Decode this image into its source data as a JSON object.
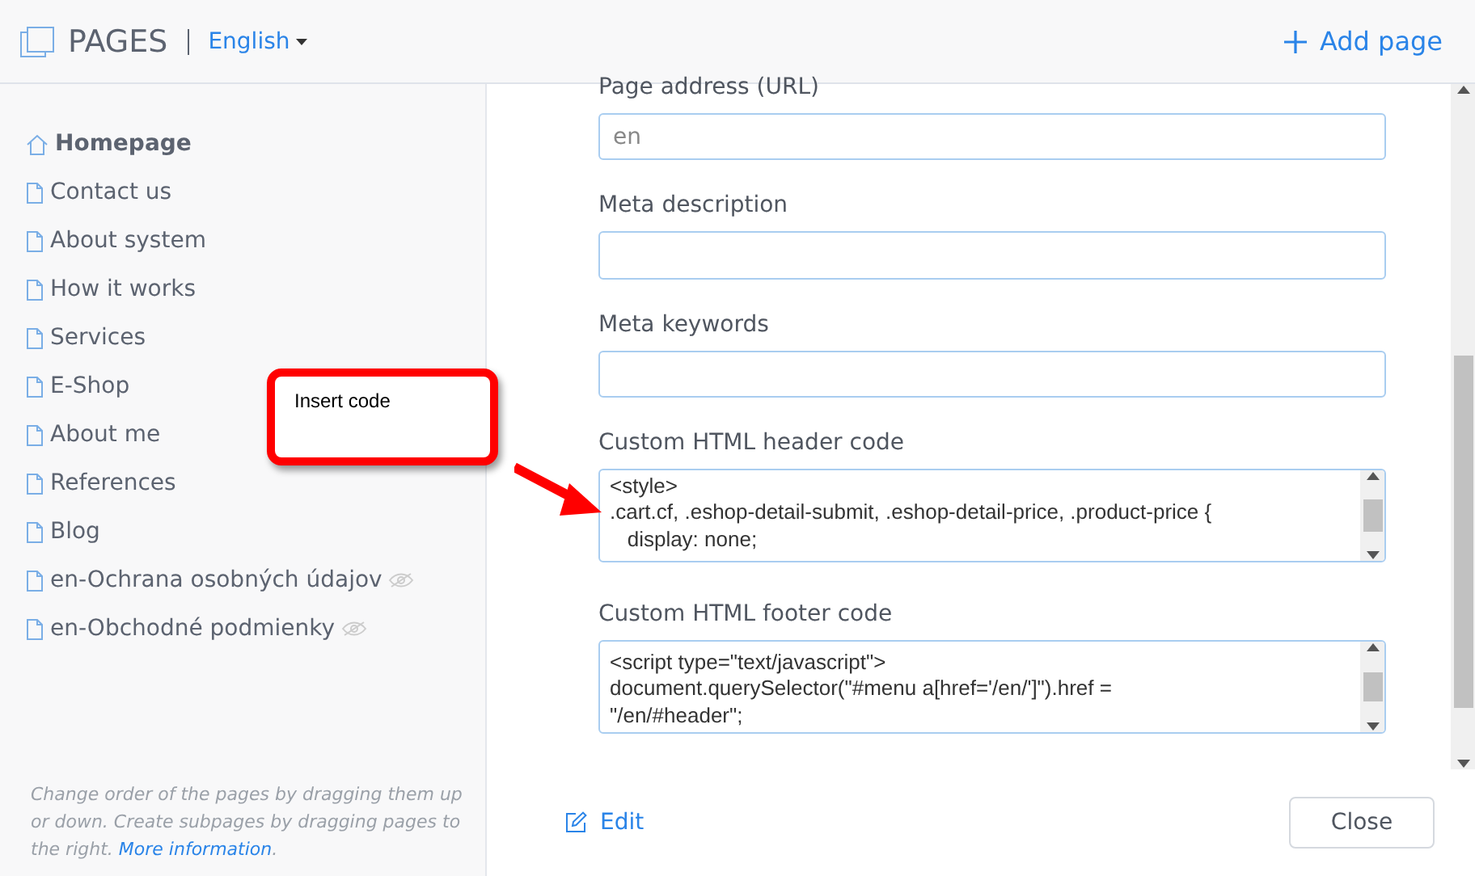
{
  "header": {
    "title": "PAGES",
    "language": "English",
    "add_button": "Add page"
  },
  "sidebar": {
    "items": [
      {
        "label": "Homepage",
        "kind": "home",
        "selected": true,
        "hidden": false
      },
      {
        "label": "Contact us",
        "kind": "page",
        "selected": false,
        "hidden": false
      },
      {
        "label": "About system",
        "kind": "page",
        "selected": false,
        "hidden": false
      },
      {
        "label": "How it works",
        "kind": "page",
        "selected": false,
        "hidden": false
      },
      {
        "label": "Services",
        "kind": "page",
        "selected": false,
        "hidden": false
      },
      {
        "label": "E-Shop",
        "kind": "page",
        "selected": false,
        "hidden": false
      },
      {
        "label": "About me",
        "kind": "page",
        "selected": false,
        "hidden": false
      },
      {
        "label": "References",
        "kind": "page",
        "selected": false,
        "hidden": false
      },
      {
        "label": "Blog",
        "kind": "page",
        "selected": false,
        "hidden": false
      },
      {
        "label": "en-Ochrana osobných údajov",
        "kind": "page",
        "selected": false,
        "hidden": true
      },
      {
        "label": "en-Obchodné podmienky",
        "kind": "page",
        "selected": false,
        "hidden": true
      }
    ],
    "hint": "Change order of the pages by dragging them up or down. Create subpages by dragging pages to the right.",
    "hint_link": "More information",
    "hint_end": "."
  },
  "form": {
    "fields": [
      {
        "label": "Page address (URL)",
        "kind": "input",
        "placeholder": "en"
      },
      {
        "label": "Meta description",
        "kind": "input"
      },
      {
        "label": "Meta keywords",
        "kind": "input"
      },
      {
        "label": "Custom HTML header code",
        "kind": "code",
        "value": "<style>\n.cart.cf, .eshop-detail-submit, .eshop-detail-price, .product-price {\n   display: none;"
      },
      {
        "label": "Custom HTML footer code",
        "kind": "code",
        "value": "<script type=\"text/javascript\">\ndocument.querySelector(\"#menu a[href='/en/']\").href =\n\"/en/#header\";"
      }
    ],
    "edit_link": "Edit",
    "close_button": "Close"
  },
  "callout": {
    "text": "Insert code"
  }
}
